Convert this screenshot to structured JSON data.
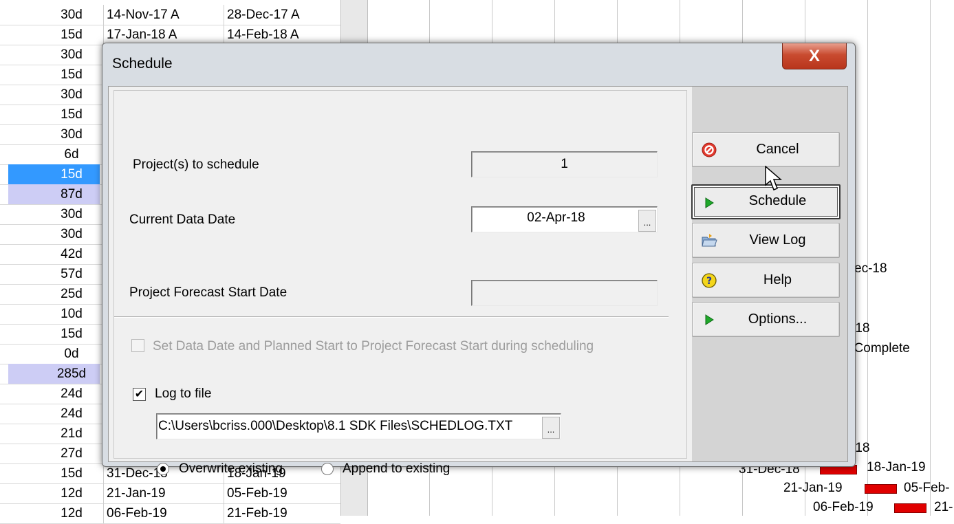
{
  "background_table": {
    "rows": [
      {
        "duration": "30d",
        "start": "14-Nov-17 A",
        "finish": "28-Dec-17 A",
        "highlight": ""
      },
      {
        "duration": "15d",
        "start": "17-Jan-18 A",
        "finish": "14-Feb-18 A",
        "highlight": ""
      },
      {
        "duration": "30d",
        "start": "",
        "finish": "",
        "highlight": ""
      },
      {
        "duration": "15d",
        "start": "",
        "finish": "",
        "highlight": ""
      },
      {
        "duration": "30d",
        "start": "",
        "finish": "",
        "highlight": ""
      },
      {
        "duration": "15d",
        "start": "",
        "finish": "",
        "highlight": ""
      },
      {
        "duration": "30d",
        "start": "",
        "finish": "",
        "highlight": ""
      },
      {
        "duration": "6d",
        "start": "",
        "finish": "",
        "highlight": ""
      },
      {
        "duration": "15d",
        "start": "",
        "finish": "",
        "highlight": "blue"
      },
      {
        "duration": "87d",
        "start": "",
        "finish": "",
        "highlight": "lavender"
      },
      {
        "duration": "30d",
        "start": "",
        "finish": "",
        "highlight": ""
      },
      {
        "duration": "30d",
        "start": "",
        "finish": "",
        "highlight": ""
      },
      {
        "duration": "42d",
        "start": "",
        "finish": "",
        "highlight": ""
      },
      {
        "duration": "57d",
        "start": "",
        "finish": "",
        "highlight": ""
      },
      {
        "duration": "25d",
        "start": "",
        "finish": "",
        "highlight": ""
      },
      {
        "duration": "10d",
        "start": "",
        "finish": "",
        "highlight": ""
      },
      {
        "duration": "15d",
        "start": "",
        "finish": "",
        "highlight": ""
      },
      {
        "duration": "0d",
        "start": "",
        "finish": "",
        "highlight": ""
      },
      {
        "duration": "285d",
        "start": "",
        "finish": "",
        "highlight": "lavender"
      },
      {
        "duration": "24d",
        "start": "",
        "finish": "",
        "highlight": ""
      },
      {
        "duration": "24d",
        "start": "",
        "finish": "",
        "highlight": ""
      },
      {
        "duration": "21d",
        "start": "",
        "finish": "",
        "highlight": ""
      },
      {
        "duration": "27d",
        "start": "",
        "finish": "",
        "highlight": ""
      },
      {
        "duration": "15d",
        "start": "31-Dec-18",
        "finish": "18-Jan-19",
        "highlight": ""
      },
      {
        "duration": "12d",
        "start": "21-Jan-19",
        "finish": "05-Feb-19",
        "highlight": ""
      },
      {
        "duration": "12d",
        "start": "06-Feb-19",
        "finish": "21-Feb-19",
        "highlight": ""
      }
    ]
  },
  "gantt_labels": {
    "dec18": "ec-18",
    "g18a": "-18",
    "complete": "f Complete",
    "g18b": "-18",
    "bar1_left": "31-Dec-18",
    "bar1_right": "18-Jan-19",
    "bar2_left": "21-Jan-19",
    "bar2_right": "05-Feb-",
    "bar3_left": "06-Feb-19",
    "bar3_right": "21-"
  },
  "dialog": {
    "title": "Schedule",
    "close_glyph": "X",
    "projects_label": "Project(s) to schedule",
    "projects_value": "1",
    "data_date_label": "Current Data Date",
    "data_date_value": "02-Apr-18",
    "ellipsis": "...",
    "forecast_label": "Project Forecast Start Date",
    "forecast_value": "",
    "set_data_date_label": "Set Data Date and Planned Start to Project Forecast Start during scheduling",
    "set_data_date_checked": false,
    "log_to_file_label": "Log to file",
    "log_to_file_checked": true,
    "check_glyph": "✔",
    "log_path": "C:\\Users\\bcriss.000\\Desktop\\8.1 SDK Files\\SCHEDLOG.TXT",
    "overwrite_label": "Overwrite existing",
    "append_label": "Append to existing",
    "selected_mode": "overwrite"
  },
  "buttons": {
    "cancel": "Cancel",
    "schedule": "Schedule",
    "view_log": "View Log",
    "help": "Help",
    "options": "Options..."
  },
  "colors": {
    "row_highlight_blue": "#3399ff",
    "row_highlight_lavender": "#cdcdf5",
    "gantt_bar": "#e00000",
    "close_button": "#c94b30"
  }
}
